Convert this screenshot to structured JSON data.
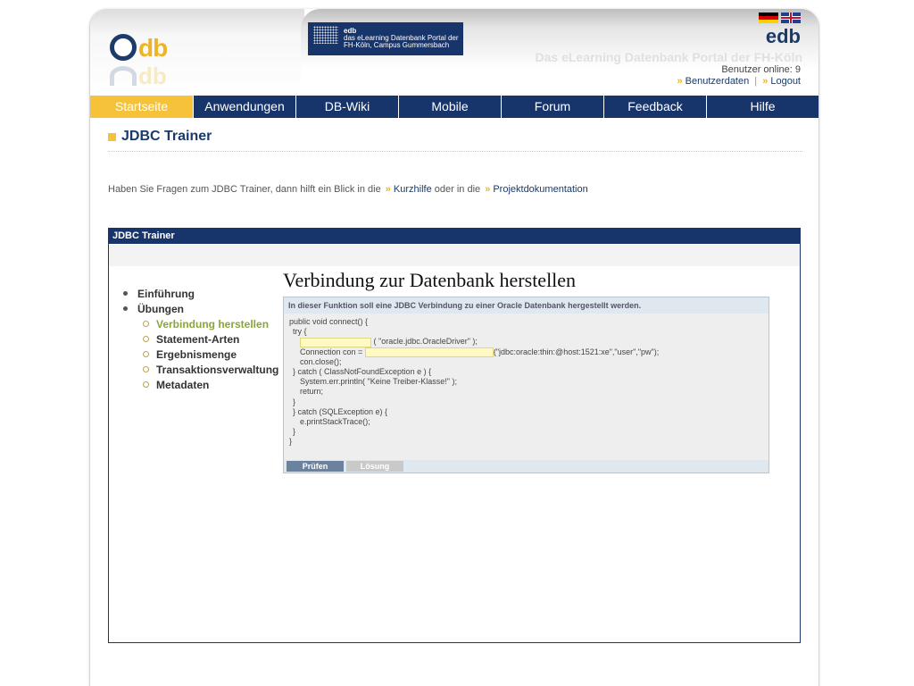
{
  "header": {
    "banner_title": "edb",
    "banner_sub": "das eLearning Datenbank Portal der FH-Köln, Campus Gummersbach",
    "site_short": "edb",
    "site_title": "Das eLearning Datenbank Portal der FH-Köln",
    "online": "Benutzer online: 9",
    "user_data": "Benutzerdaten",
    "separator": "|",
    "logout": "Logout"
  },
  "nav": [
    {
      "label": "Startseite",
      "active": true
    },
    {
      "label": "Anwendungen"
    },
    {
      "label": "DB-Wiki"
    },
    {
      "label": "Mobile"
    },
    {
      "label": "Forum"
    },
    {
      "label": "Feedback"
    },
    {
      "label": "Hilfe"
    }
  ],
  "page": {
    "title": "JDBC Trainer",
    "help_text_1": "Haben Sie Fragen zum JDBC Trainer, dann hilft ein Blick in die",
    "help_link_1": "Kurzhilfe",
    "help_text_2": "oder in die",
    "help_link_2": "Projektdokumentation"
  },
  "trainer": {
    "box_title": "JDBC Trainer",
    "tree": {
      "intro": "Einführung",
      "exercises": "Übungen",
      "items": [
        "Verbindung herstellen",
        "Statement-Arten",
        "Ergebnismenge",
        "Transaktionsverwaltung",
        "Metadaten"
      ]
    },
    "exercise_title": "Verbindung zur Datenbank herstellen",
    "exercise_desc": "In dieser Funktion soll eine JDBC Verbindung zu einer Oracle Datenbank hergestellt werden.",
    "code": {
      "l1": "public void connect() {",
      "l2": "try {",
      "l3": "( \"oracle.jdbc.OracleDriver\" );",
      "l4a": "Connection con =",
      "l4b": "(\"jdbc:oracle:thin:@host:1521:xe\",\"user\",\"pw\");",
      "l5": "con.close();",
      "l6": "} catch ( ClassNotFoundException e ) {",
      "l7": "System.err.println( \"Keine Treiber-Klasse!\" );",
      "l8": "return;",
      "l9": "}",
      "l10": "} catch (SQLException e) {",
      "l11": "e.printStackTrace();",
      "l12": "}",
      "l13": "}"
    },
    "btn_check": "Prüfen",
    "btn_solution": "Lösung"
  }
}
